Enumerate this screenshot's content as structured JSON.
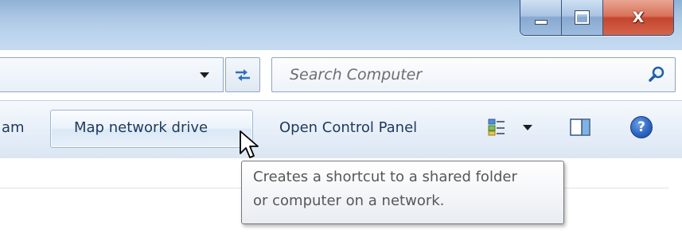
{
  "window": {
    "minimize_icon": "minimize-icon",
    "maximize_icon": "maximize-icon",
    "close_icon": "close-icon",
    "close_glyph": "X"
  },
  "address": {
    "dropdown_icon": "chevron-down-icon",
    "refresh_icon": "refresh-arrows-icon"
  },
  "search": {
    "placeholder": "Search Computer",
    "icon": "search-icon"
  },
  "toolbar": {
    "truncated_item_label": "am",
    "map_network_drive_label": "Map network drive",
    "open_control_panel_label": "Open Control Panel",
    "views_icon": "change-view-icon",
    "views_dropdown_icon": "chevron-down-icon",
    "preview_pane_icon": "preview-pane-icon",
    "help_icon": "help-icon",
    "help_glyph": "?"
  },
  "tooltip": {
    "line1": "Creates a shortcut to a shared folder",
    "line2": "or computer on a network."
  },
  "colors": {
    "title_glass": "#a7c3e2",
    "close_red": "#c4452d",
    "command_text": "#1e395b",
    "tooltip_text": "#575757"
  }
}
